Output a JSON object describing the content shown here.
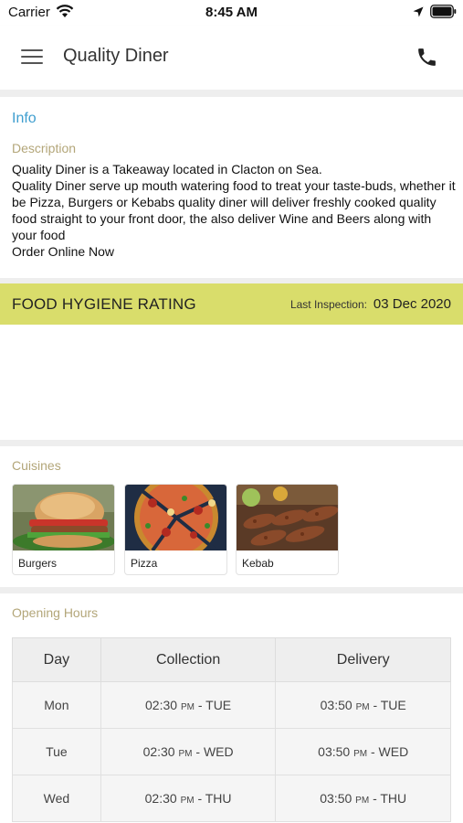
{
  "status_bar": {
    "carrier": "Carrier",
    "time": "8:45 AM"
  },
  "header": {
    "title": "Quality Diner"
  },
  "info": {
    "heading": "Info",
    "description_label": "Description",
    "description": "Quality Diner is a Takeaway located in Clacton on Sea.\nQuality Diner serve up mouth watering food to treat your taste-buds, whether it be Pizza, Burgers or Kebabs quality diner will deliver freshly cooked quality food straight to your front door, the also deliver Wine and Beers along with your food\nOrder Online Now"
  },
  "hygiene": {
    "title": "FOOD HYGIENE RATING",
    "last_inspection_label": "Last Inspection:",
    "last_inspection_date": "03 Dec 2020",
    "bar_color": "#d9dd6b"
  },
  "cuisines": {
    "label": "Cuisines",
    "items": [
      {
        "name": "Burgers"
      },
      {
        "name": "Pizza"
      },
      {
        "name": "Kebab"
      }
    ]
  },
  "opening_hours": {
    "label": "Opening Hours",
    "columns": [
      "Day",
      "Collection",
      "Delivery"
    ],
    "rows": [
      {
        "day": "Mon",
        "collection": {
          "time": "02:30",
          "ampm": "PM",
          "until": "- TUE"
        },
        "delivery": {
          "time": "03:50",
          "ampm": "PM",
          "until": "- TUE"
        }
      },
      {
        "day": "Tue",
        "collection": {
          "time": "02:30",
          "ampm": "PM",
          "until": "- WED"
        },
        "delivery": {
          "time": "03:50",
          "ampm": "PM",
          "until": "- WED"
        }
      },
      {
        "day": "Wed",
        "collection": {
          "time": "02:30",
          "ampm": "PM",
          "until": "- THU"
        },
        "delivery": {
          "time": "03:50",
          "ampm": "PM",
          "until": "- THU"
        }
      }
    ]
  },
  "colors": {
    "info_heading": "#3f9ecf",
    "section_label": "#b3a679"
  },
  "icons": [
    "wifi-icon",
    "location-arrow-icon",
    "battery-icon",
    "hamburger-menu-icon",
    "phone-icon"
  ]
}
